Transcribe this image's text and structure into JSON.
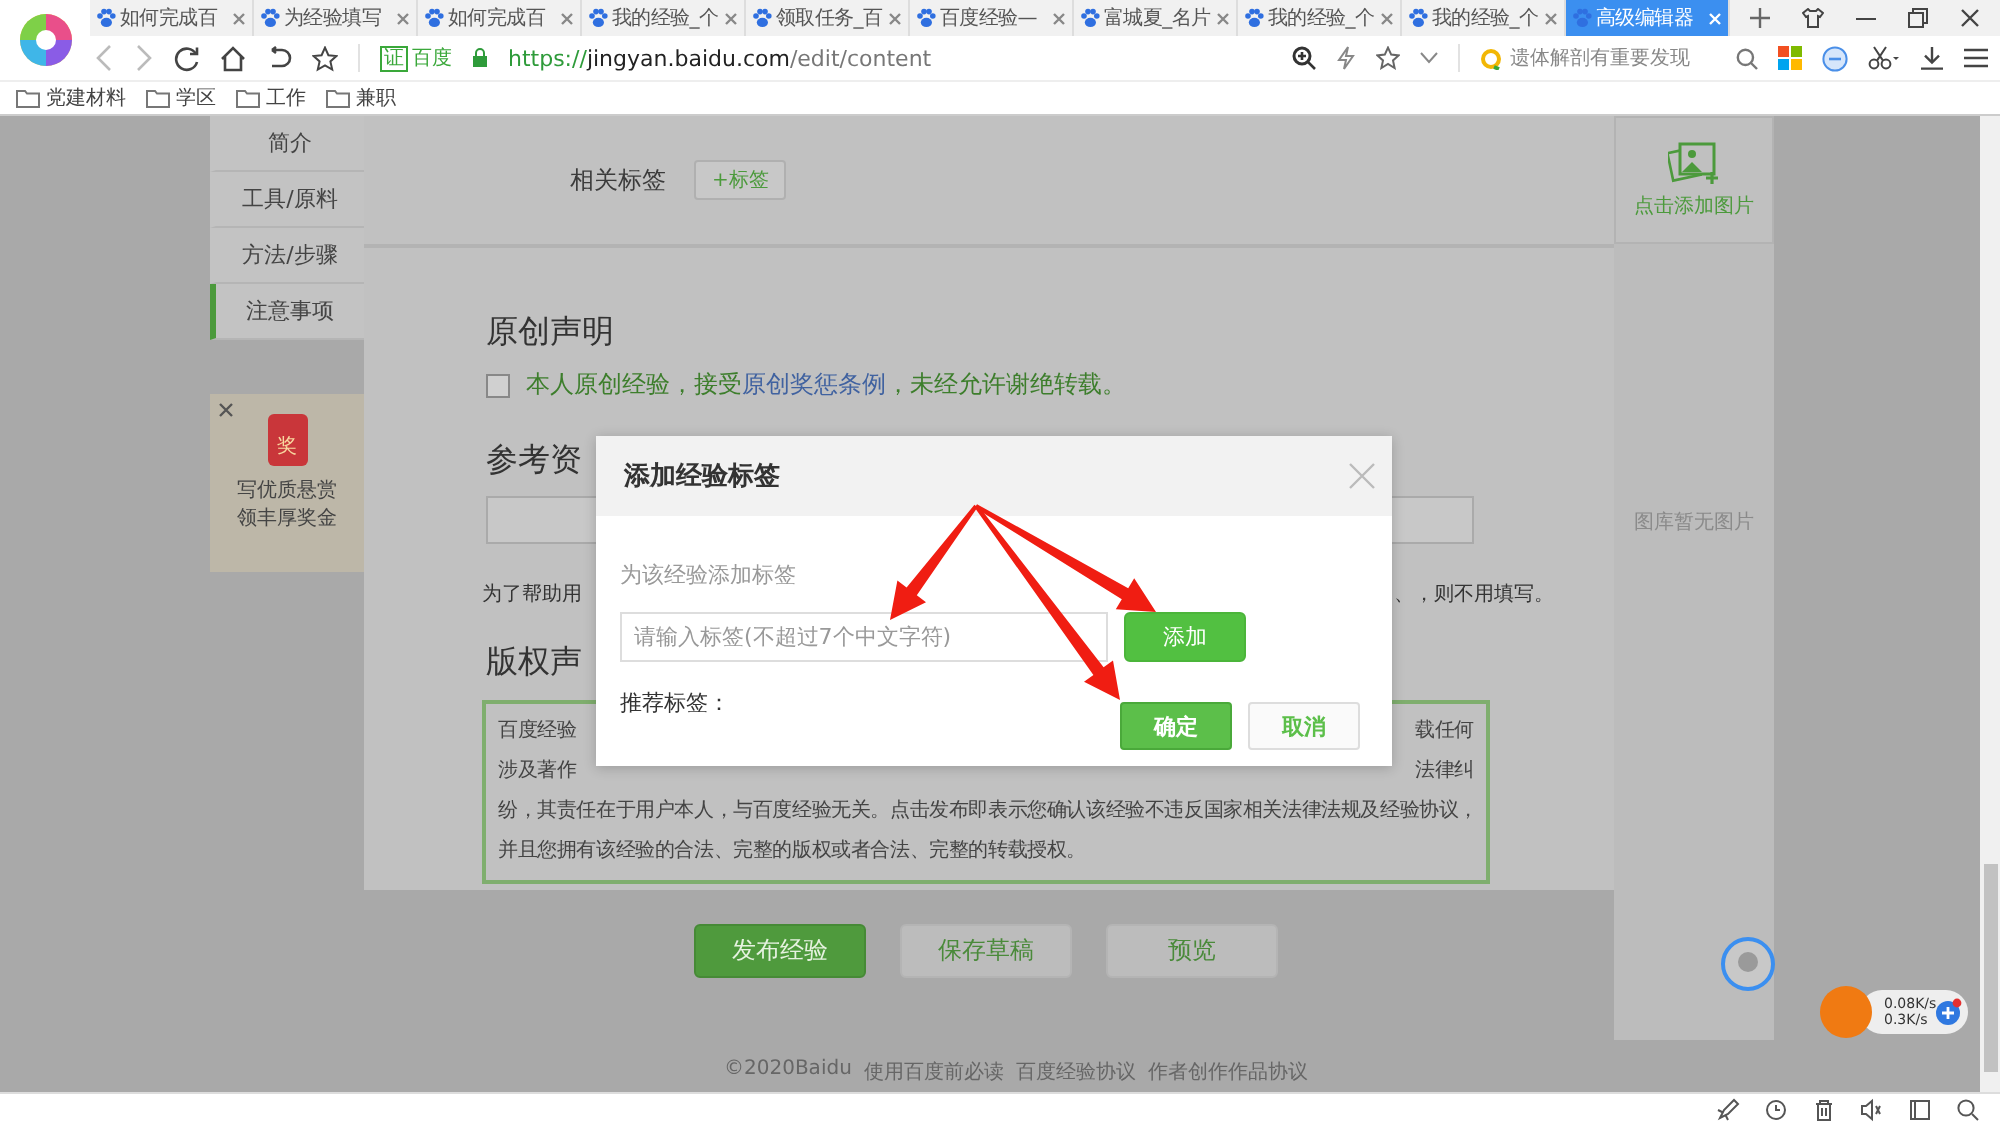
{
  "browser": {
    "tabs": [
      {
        "title": "如何完成百",
        "selected": false
      },
      {
        "title": "为经验填写",
        "selected": false
      },
      {
        "title": "如何完成百",
        "selected": false
      },
      {
        "title": "我的经验_个",
        "selected": false
      },
      {
        "title": "领取任务_百",
        "selected": false
      },
      {
        "title": "百度经验—",
        "selected": false
      },
      {
        "title": "富城夏_名片",
        "selected": false
      },
      {
        "title": "我的经验_个",
        "selected": false
      },
      {
        "title": "我的经验_个",
        "selected": false
      },
      {
        "title": "高级编辑器",
        "selected": true
      }
    ],
    "cert_badge": "证",
    "site_name": "百度",
    "url": {
      "scheme": "https://",
      "host": "jingyan.baidu.com",
      "path": "/edit/content"
    },
    "search_placeholder": "遗体解剖有重要发现",
    "bookmarks": [
      "党建材料",
      "学区",
      "工作",
      "兼职"
    ]
  },
  "nav": {
    "items": [
      {
        "label": "简介",
        "selected": false
      },
      {
        "label": "工具/原料",
        "selected": false
      },
      {
        "label": "方法/步骤",
        "selected": false
      },
      {
        "label": "注意事项",
        "selected": true
      }
    ]
  },
  "promo": {
    "badge": "奖",
    "lines": [
      "写优质悬赏",
      "领丰厚奖金"
    ]
  },
  "tags_row": {
    "label": "相关标签",
    "button": "+标签"
  },
  "original": {
    "heading": "原创声明",
    "checked": false,
    "before": "本人原创经验，接受",
    "link": "原创奖惩条例",
    "after": "，未经允许谢绝转载。"
  },
  "references": {
    "heading": "参考资",
    "hint_left": "为了帮助用",
    "hint_right": "、，则不用填写。"
  },
  "copyright": {
    "heading": "版权声",
    "lines": [
      {
        "left": "百度经验",
        "right": "载任何"
      },
      {
        "left": "涉及著作",
        "right": "法律纠"
      },
      {
        "text": "纷，其责任在于用户本人，与百度经验无关。点击发布即表示您确认该经验不违反国家相关法律法规及经验协议，"
      },
      {
        "text": "并且您拥有该经验的合法、完整的版权或者合法、完整的转载授权。"
      }
    ]
  },
  "actions": [
    {
      "label": "发布经验",
      "kind": "primary"
    },
    {
      "label": "保存草稿",
      "kind": "secondary"
    },
    {
      "label": "预览",
      "kind": "secondary"
    }
  ],
  "footer": {
    "copyright": "©2020Baidu",
    "links": [
      "使用百度前必读",
      "百度经验协议",
      "作者创作作品协议"
    ]
  },
  "image_panel": {
    "add_label": "点击添加图片",
    "empty_text": "图库暂无图片"
  },
  "speed_widget": {
    "down": "0.08K/s",
    "up": "0.3K/s"
  },
  "dialog": {
    "title": "添加经验标签",
    "prompt": "为该经验添加标签",
    "input_placeholder": "请输入标签(不超过7个中文字符)",
    "add_button": "添加",
    "recommended_label": "推荐标签：",
    "buttons": [
      {
        "label": "确定",
        "kind": "primary"
      },
      {
        "label": "取消",
        "kind": "secondary"
      }
    ]
  }
}
